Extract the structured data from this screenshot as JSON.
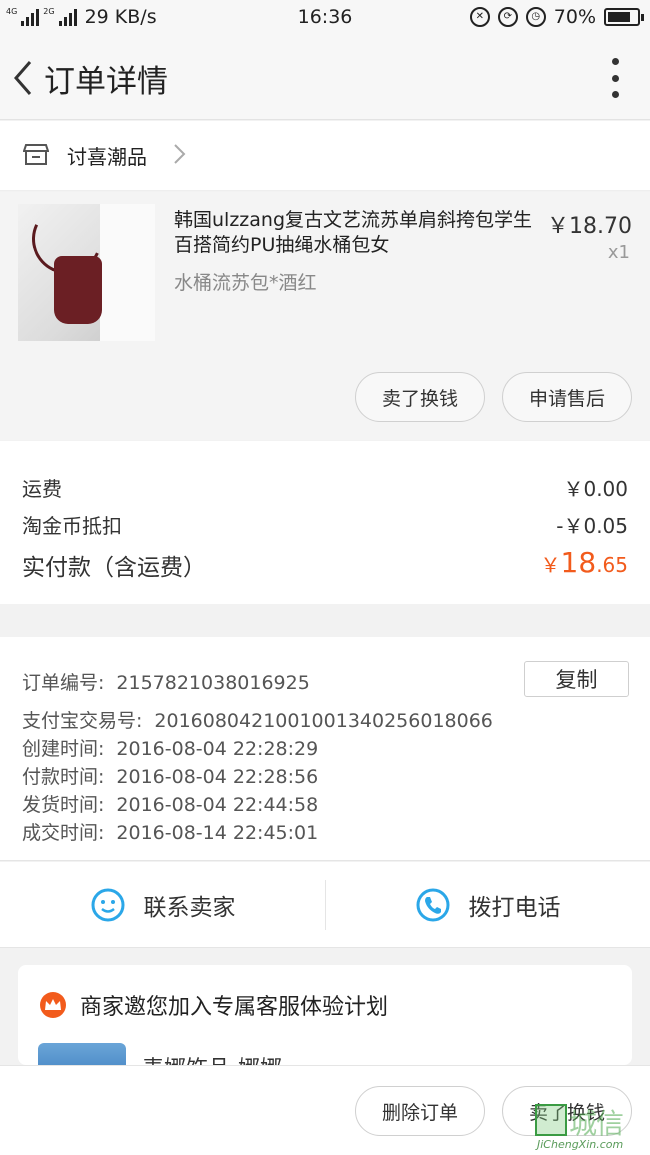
{
  "status_bar": {
    "network_1": "4G",
    "network_2": "2G",
    "speed": "29 KB/s",
    "time": "16:36",
    "battery": "70%",
    "battery_level": 0.7
  },
  "navbar": {
    "title": "订单详情"
  },
  "shop": {
    "name": "讨喜潮品"
  },
  "product": {
    "name": "韩国ulzzang复古文艺流苏单肩斜挎包学生百搭简约PU抽绳水桶包女",
    "spec": "水桶流苏包*酒红",
    "price": "￥18.70",
    "qty": "x1",
    "btn_sell": "卖了换钱",
    "btn_after_sale": "申请售后"
  },
  "summary": {
    "shipping_label": "运费",
    "shipping_value": "￥0.00",
    "coin_label": "淘金币抵扣",
    "coin_value": "-￥0.05",
    "paid_label": "实付款（含运费）",
    "paid_currency": "￥",
    "paid_int": "18",
    "paid_dec": ".65",
    "accent_color": "#f25b1c"
  },
  "order_info": {
    "order_no_label": "订单编号:",
    "order_no": "2157821038016925",
    "copy_label": "复制",
    "alipay_label": "支付宝交易号:",
    "alipay_no": "2016080421001001340256018066",
    "created_label": "创建时间:",
    "created": "2016-08-04 22:28:29",
    "paid_label": "付款时间:",
    "paid": "2016-08-04 22:28:56",
    "shipped_label": "发货时间:",
    "shipped": "2016-08-04 22:44:58",
    "done_label": "成交时间:",
    "done": "2016-08-14 22:45:01"
  },
  "contact": {
    "seller_label": "联系卖家",
    "call_label": "拨打电话",
    "icon_color": "#2ba7e8"
  },
  "promo": {
    "title": "商家邀您加入专属客服体验计划",
    "name": "麦娜饰品-娜娜"
  },
  "bottom": {
    "delete_label": "删除订单",
    "sell_label": "卖了换钱"
  },
  "watermark": {
    "cn": "城信",
    "en": "JiChengXin.com"
  }
}
